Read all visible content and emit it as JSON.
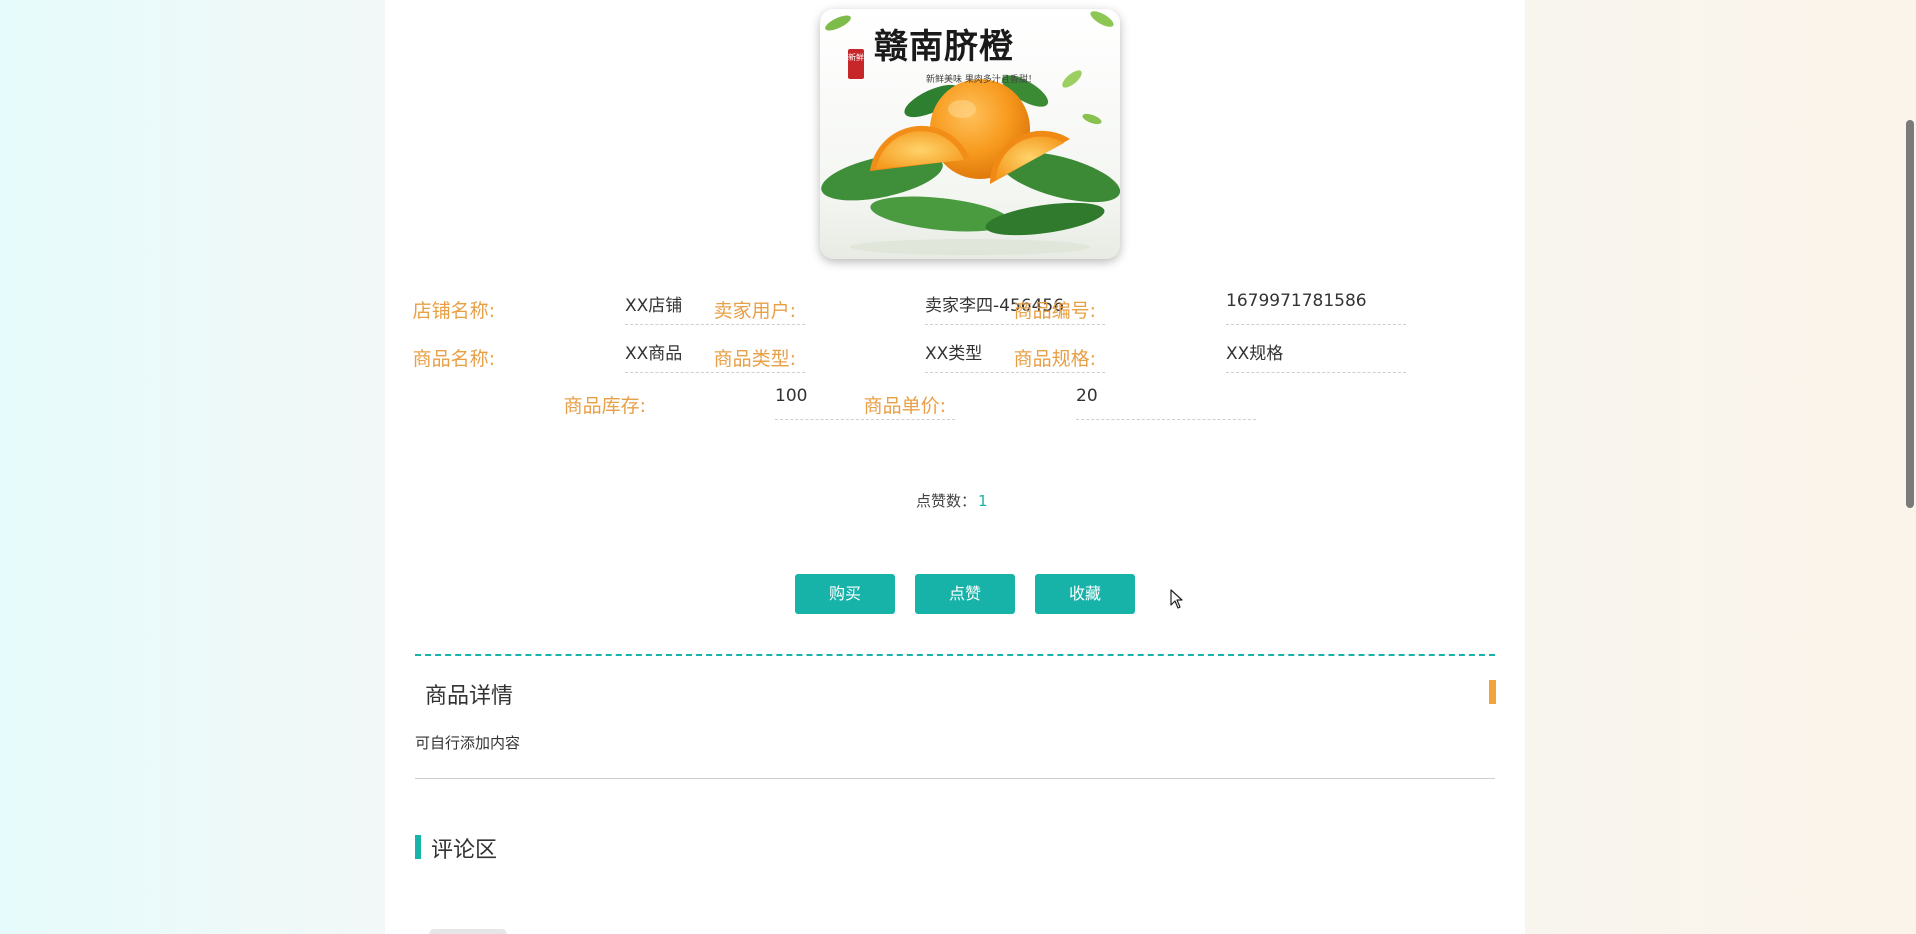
{
  "product_image": {
    "title": "赣南脐橙",
    "subtitle": "新鲜美味 果肉多汁且香甜！",
    "seal": "新鲜"
  },
  "fields": [
    {
      "label": "店铺名称:",
      "value": "XX店铺"
    },
    {
      "label": "卖家用户:",
      "value": "卖家李四-456456"
    },
    {
      "label": "商品编号:",
      "value": "1679971781586"
    },
    {
      "label": "商品名称:",
      "value": "XX商品"
    },
    {
      "label": "商品类型:",
      "value": "XX类型"
    },
    {
      "label": "商品规格:",
      "value": "XX规格"
    },
    {
      "label": "商品库存:",
      "value": "100"
    },
    {
      "label": "商品单价:",
      "value": "20"
    }
  ],
  "likes": {
    "label": "点赞数：",
    "count": "1"
  },
  "buttons": {
    "buy": "购买",
    "like": "点赞",
    "favorite": "收藏"
  },
  "details": {
    "title": "商品详情",
    "text": "可自行添加内容"
  },
  "comments": {
    "title": "评论区"
  },
  "colors": {
    "accent": "#17b3a9",
    "label": "#e8a047",
    "marker": "#f0a43a"
  }
}
